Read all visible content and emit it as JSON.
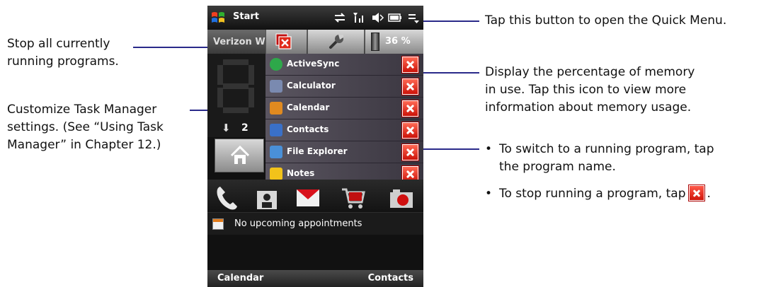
{
  "annotations": {
    "quick_menu": "Tap this button to open the Quick Menu.",
    "stop_all_line1": "Stop all currently",
    "stop_all_line2": "running programs.",
    "customize_line1": "Customize Task Manager",
    "customize_line2": "settings. (See “Using Task",
    "customize_line3": "Manager” in Chapter 12.)",
    "memory_line1": "Display the percentage of memory",
    "memory_line2": "in use. Tap this icon to view more",
    "memory_line3": "information about memory usage.",
    "bullet1_line1": "To switch to a running program, tap",
    "bullet1_line2": "the program name.",
    "bullet2_before": "To stop running a program, tap",
    "bullet2_after": ".",
    "bullet_char": "•"
  },
  "titlebar": {
    "start_label": "Start",
    "icons": [
      "sync-icon",
      "signal-icon",
      "volume-icon",
      "battery-icon",
      "quick-menu-icon"
    ]
  },
  "tabs": {
    "carrier": "Verizon W",
    "memory_percent": "36 %"
  },
  "home": {
    "download_count": "2"
  },
  "tasks": [
    {
      "name": "ActiveSync",
      "icon": "activesync-icon",
      "color": "#2ea84a"
    },
    {
      "name": "Calculator",
      "icon": "calculator-icon",
      "color": "#7a8ab0"
    },
    {
      "name": "Calendar",
      "icon": "calendar-icon",
      "color": "#e08a20"
    },
    {
      "name": "Contacts",
      "icon": "contacts-icon",
      "color": "#3a70c8"
    },
    {
      "name": "File Explorer",
      "icon": "file-explorer-icon",
      "color": "#4a90d8"
    },
    {
      "name": "Notes",
      "icon": "notes-icon",
      "color": "#f2c21a"
    }
  ],
  "appointment": {
    "text": "No upcoming appointments"
  },
  "softkeys": {
    "left": "Calendar",
    "right": "Contacts"
  },
  "colors": {
    "callout_line": "#2a2a8a",
    "close_red": "#d0140a"
  }
}
